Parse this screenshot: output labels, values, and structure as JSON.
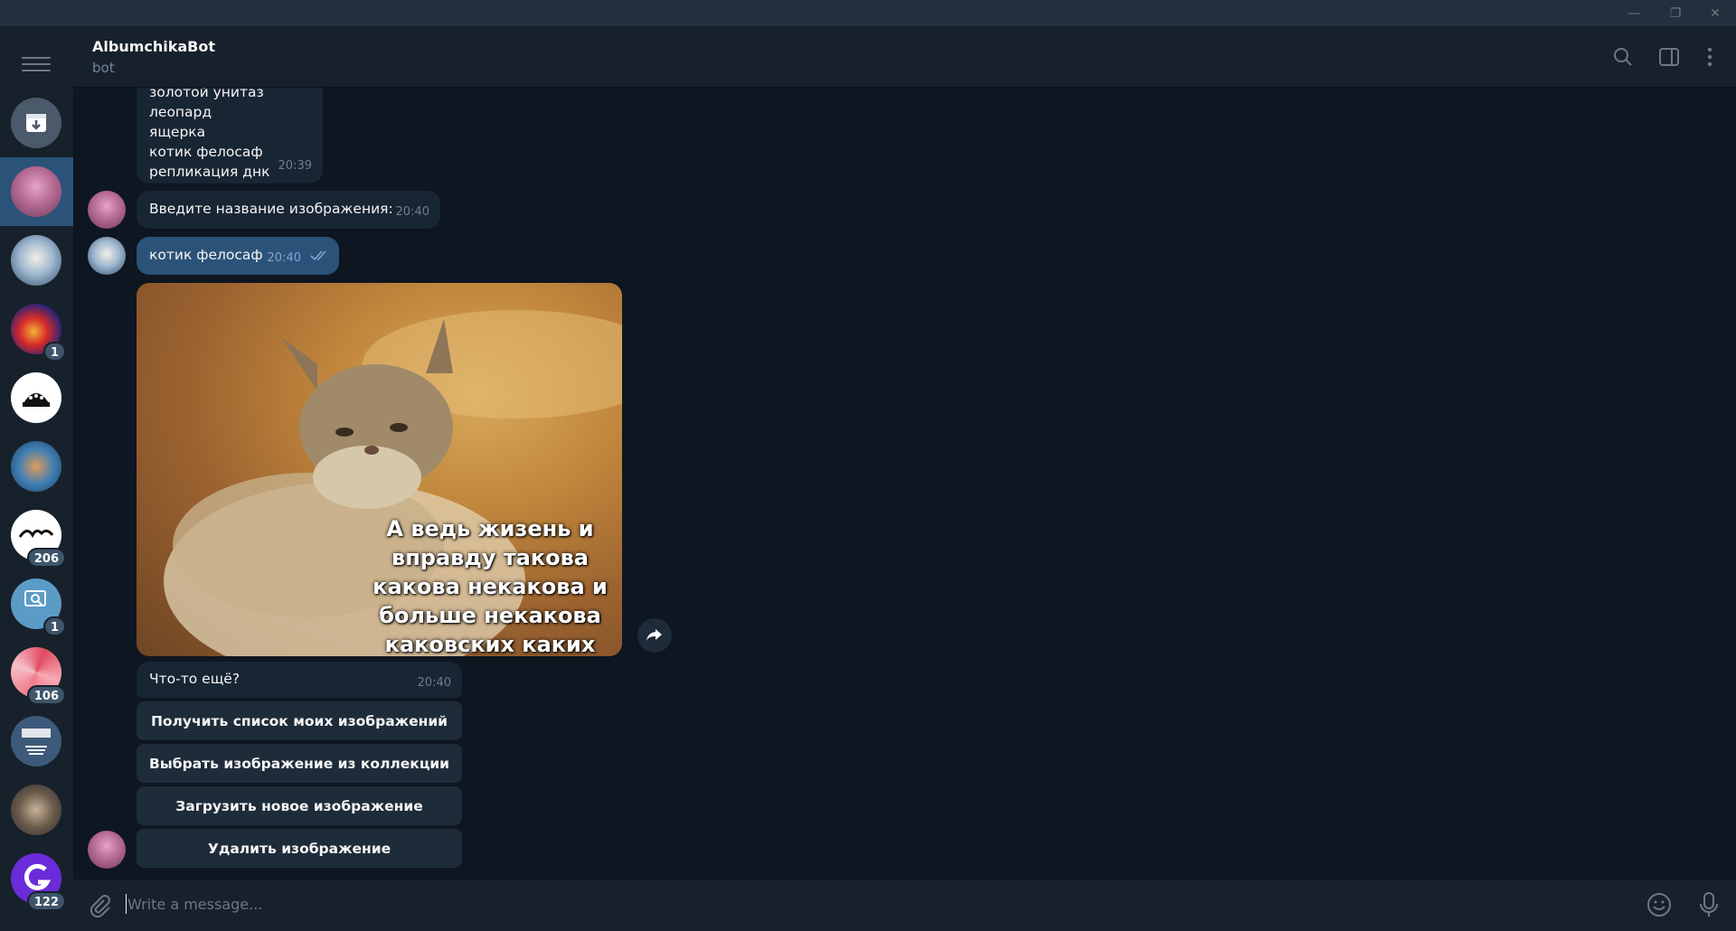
{
  "window": {
    "min_label": "—",
    "max_label": "❐",
    "close_label": "✕"
  },
  "sidebar": {
    "badges": [
      "1",
      "206",
      "1",
      "106",
      "122"
    ]
  },
  "header": {
    "title": "AlbumchikaBot",
    "subtitle": "bot"
  },
  "messages": {
    "list_lines": [
      "золотой унитаз",
      "леопард",
      "ящерка",
      "котик фелосаф",
      "репликация днк"
    ],
    "list_time": "20:39",
    "prompt_text": "Введите название изображения:",
    "prompt_time": "20:40",
    "reply_text": "котик фелосаф",
    "reply_time": "20:40",
    "image_caption_lines": [
      "А ведь жизень и",
      "вправду такова",
      "какова некакова и",
      "больше некакова",
      "каковских каких"
    ],
    "followup_text": "Что-то ещё?",
    "followup_time": "20:40"
  },
  "keyboard": {
    "buttons": [
      "Получить список моих изображений",
      "Выбрать изображение из коллекции",
      "Загрузить новое изображение",
      "Удалить изображение"
    ]
  },
  "composer": {
    "placeholder": "Write a message..."
  },
  "colors": {
    "accent": "#2b5278",
    "bg": "#0e1621",
    "panel": "#17212b"
  }
}
